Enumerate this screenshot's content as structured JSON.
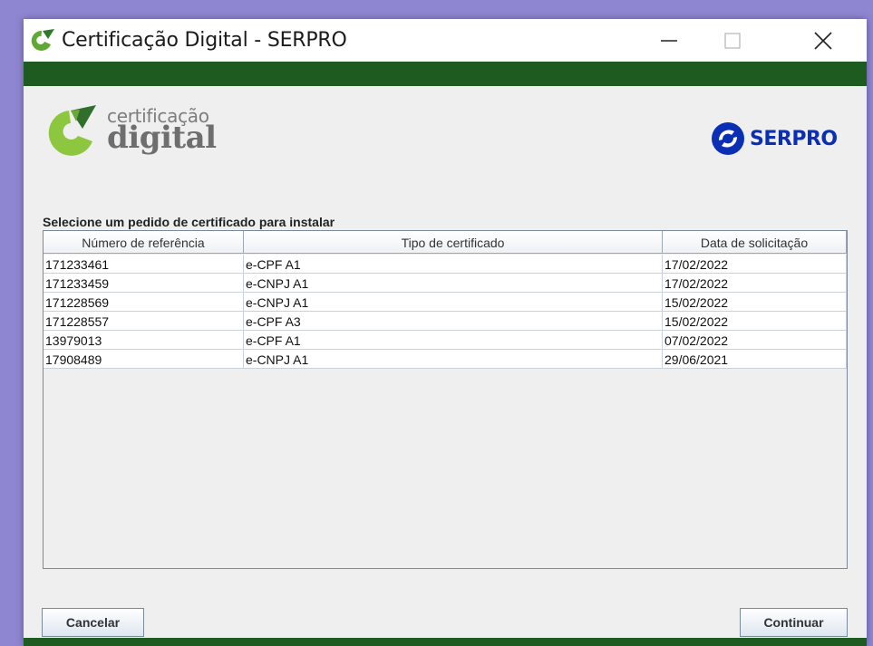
{
  "window": {
    "title": "Certificação Digital - SERPRO",
    "controls": {
      "minimize": "minimize-icon",
      "maximize": "maximize-icon",
      "close": "close-icon"
    }
  },
  "branding": {
    "logo_small": "certificação",
    "logo_big": "digital",
    "partner": "SERPRO",
    "colors": {
      "green_dark": "#1e5b20",
      "green_light": "#8dc63f",
      "serpro_blue": "#0a2fb5"
    }
  },
  "instruction": "Selecione um pedido de certificado para instalar",
  "table": {
    "columns": [
      "Número de referência",
      "Tipo de certificado",
      "Data de solicitação"
    ],
    "rows": [
      [
        "171233461",
        "e-CPF A1",
        "17/02/2022"
      ],
      [
        "171233459",
        "e-CNPJ A1",
        "17/02/2022"
      ],
      [
        "171228569",
        "e-CNPJ A1",
        "15/02/2022"
      ],
      [
        "171228557",
        "e-CPF A3",
        "15/02/2022"
      ],
      [
        "13979013",
        "e-CPF A1",
        "07/02/2022"
      ],
      [
        "17908489",
        "e-CNPJ A1",
        "29/06/2021"
      ]
    ]
  },
  "buttons": {
    "cancel": "Cancelar",
    "continue": "Continuar"
  }
}
